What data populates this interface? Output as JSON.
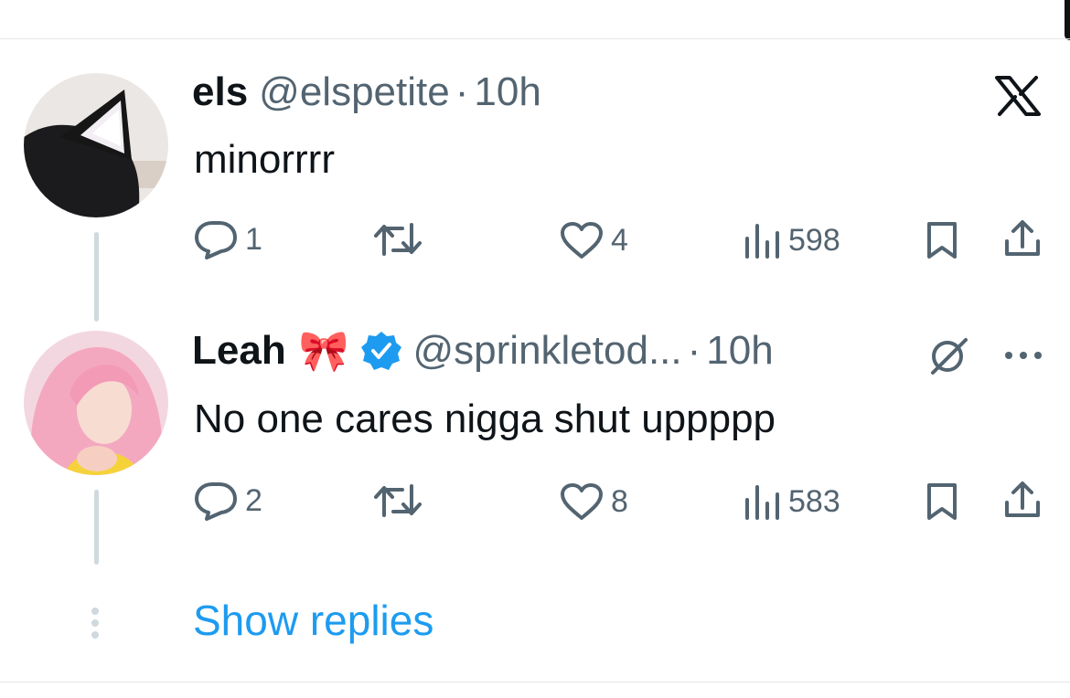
{
  "tweets": [
    {
      "name": "els",
      "handle": "@elspetite",
      "time": "10h",
      "text": "minorrrr",
      "replies": "1",
      "likes": "4",
      "views": "598"
    },
    {
      "name": "Leah",
      "emoji": "🎀",
      "handle": "@sprinkletod...",
      "time": "10h",
      "text": "No one cares nigga shut uppppp",
      "replies": "2",
      "likes": "8",
      "views": "583"
    }
  ],
  "separator": "·",
  "show_replies_label": "Show replies",
  "colors": {
    "text": "#0f1419",
    "muted": "#536471",
    "link": "#1d9bf0",
    "verified": "#1d9bf0",
    "thread_line": "#cfd9de"
  },
  "icons": [
    "x-logo-icon",
    "reply-icon",
    "retweet-icon",
    "like-icon",
    "views-icon",
    "bookmark-icon",
    "share-icon",
    "verified-badge-icon",
    "grok-icon",
    "more-icon",
    "thread-dots-icon"
  ]
}
